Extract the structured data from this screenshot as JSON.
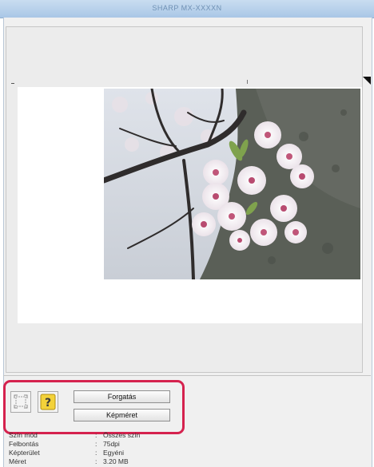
{
  "window": {
    "title": "SHARP MX-XXXXN"
  },
  "toolbar": {
    "rotate_label": "Forgatás",
    "image_size_label": "Képméret"
  },
  "icons": {
    "crop": "crop-icon",
    "help": "help-icon",
    "help_glyph": "?"
  },
  "info": {
    "rows": [
      {
        "label": "Szín mód",
        "sep": ":",
        "value": "Összes szín"
      },
      {
        "label": "Felbontás",
        "sep": ":",
        "value": "75dpi"
      },
      {
        "label": "Képterület",
        "sep": ":",
        "value": "Egyéni"
      },
      {
        "label": "Méret",
        "sep": ":",
        "value": "3.20 MB"
      }
    ]
  },
  "colors": {
    "highlight": "#d5224e",
    "titlebar": "#b9d1ea",
    "help_icon": "#f3d23a"
  }
}
